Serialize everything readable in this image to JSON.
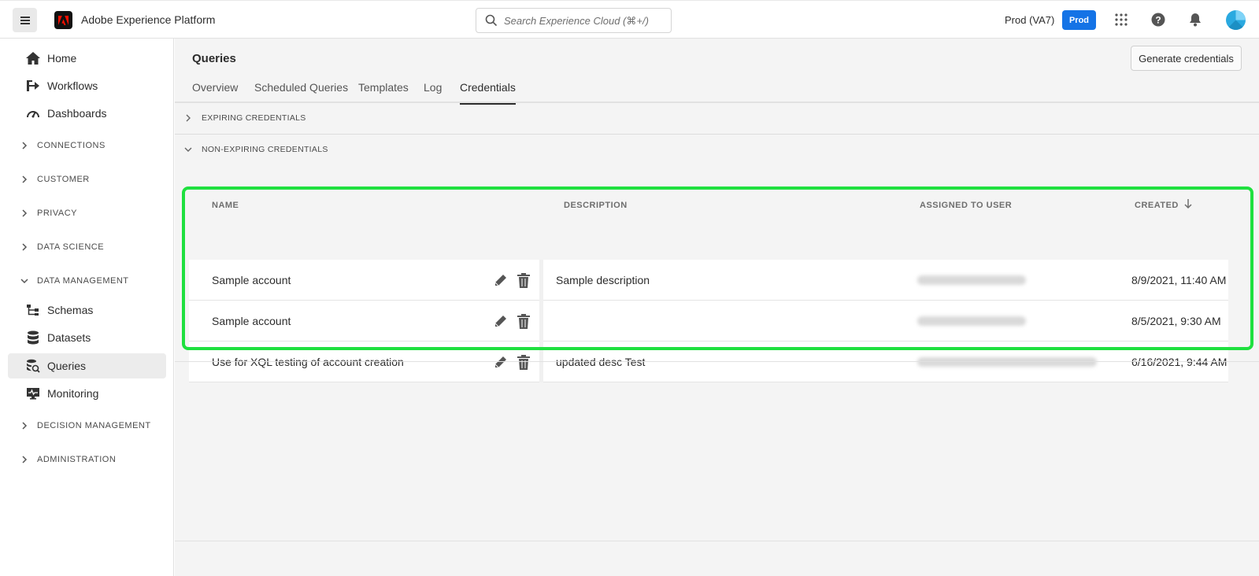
{
  "header": {
    "app_title": "Adobe Experience Platform",
    "search_placeholder": "Search Experience Cloud (⌘+/)",
    "org_label": "Prod (VA7)",
    "sandbox_badge": "Prod",
    "accent_color": "#1473e6"
  },
  "sidebar": {
    "top_items": [
      {
        "label": "Home",
        "icon": "home-icon"
      },
      {
        "label": "Workflows",
        "icon": "workflows-icon"
      },
      {
        "label": "Dashboards",
        "icon": "dashboards-icon"
      }
    ],
    "groups": [
      "CONNECTIONS",
      "CUSTOMER",
      "PRIVACY",
      "DATA SCIENCE",
      "DATA MANAGEMENT"
    ],
    "data_management_items": [
      {
        "label": "Schemas",
        "icon": "schemas-icon"
      },
      {
        "label": "Datasets",
        "icon": "datasets-icon"
      },
      {
        "label": "Queries",
        "icon": "queries-icon",
        "active": true
      },
      {
        "label": "Monitoring",
        "icon": "monitoring-icon"
      }
    ],
    "bottom_groups": [
      "DECISION MANAGEMENT",
      "ADMINISTRATION"
    ]
  },
  "main": {
    "title": "Queries",
    "generate_button": "Generate credentials",
    "tabs": [
      "Overview",
      "Scheduled Queries",
      "Templates",
      "Log",
      "Credentials"
    ],
    "active_tab": "Credentials",
    "sections": {
      "expiring": "EXPIRING CREDENTIALS",
      "non_expiring": "NON-EXPIRING CREDENTIALS"
    },
    "table": {
      "columns": [
        "NAME",
        "DESCRIPTION",
        "ASSIGNED TO USER",
        "CREATED"
      ],
      "rows": [
        {
          "name": "Sample account",
          "description": "Sample description",
          "assigned": "",
          "created": "8/9/2021, 11:40 AM"
        },
        {
          "name": "Sample account",
          "description": "",
          "assigned": "",
          "created": "8/5/2021, 9:30 AM"
        },
        {
          "name": "Use for XQL testing of account creation",
          "description": "updated desc Test",
          "assigned": "",
          "created": "6/16/2021, 9:44 AM"
        }
      ]
    },
    "highlight_color": "#1fe03f"
  }
}
